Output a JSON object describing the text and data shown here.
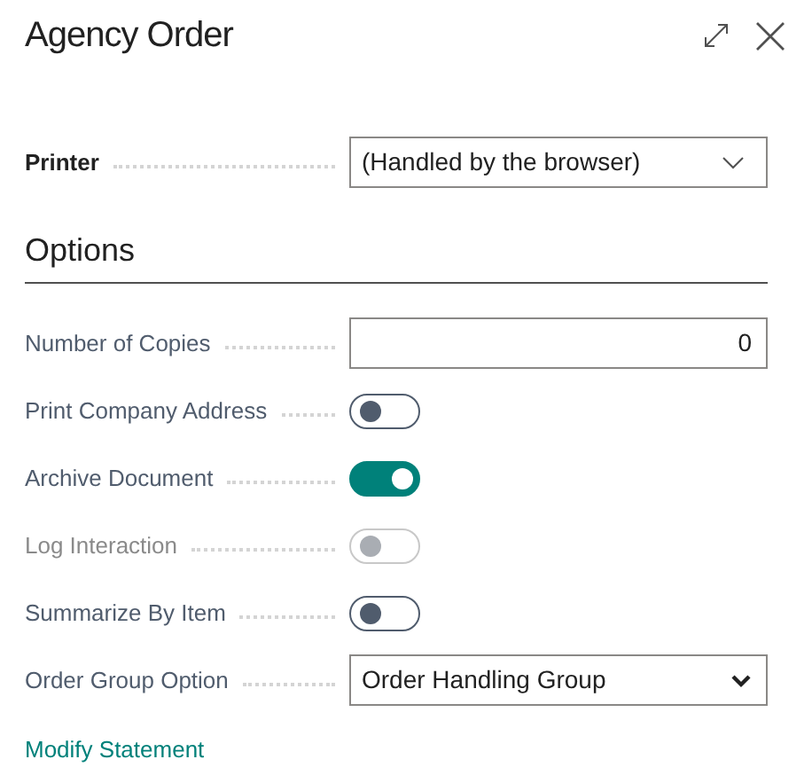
{
  "dialog": {
    "title": "Agency Order"
  },
  "printer": {
    "label": "Printer",
    "value": "(Handled by the browser)"
  },
  "options": {
    "heading": "Options",
    "fields": [
      {
        "kind": "text",
        "label": "Number of Copies",
        "value": "0"
      },
      {
        "kind": "toggle",
        "label": "Print Company Address",
        "on": false,
        "disabled": false
      },
      {
        "kind": "toggle",
        "label": "Archive Document",
        "on": true,
        "disabled": false
      },
      {
        "kind": "toggle",
        "label": "Log Interaction",
        "on": false,
        "disabled": true
      },
      {
        "kind": "toggle",
        "label": "Summarize By Item",
        "on": false,
        "disabled": false
      },
      {
        "kind": "select",
        "label": "Order Group Option",
        "value": "Order Handling Group"
      }
    ]
  },
  "link": "Modify Statement"
}
